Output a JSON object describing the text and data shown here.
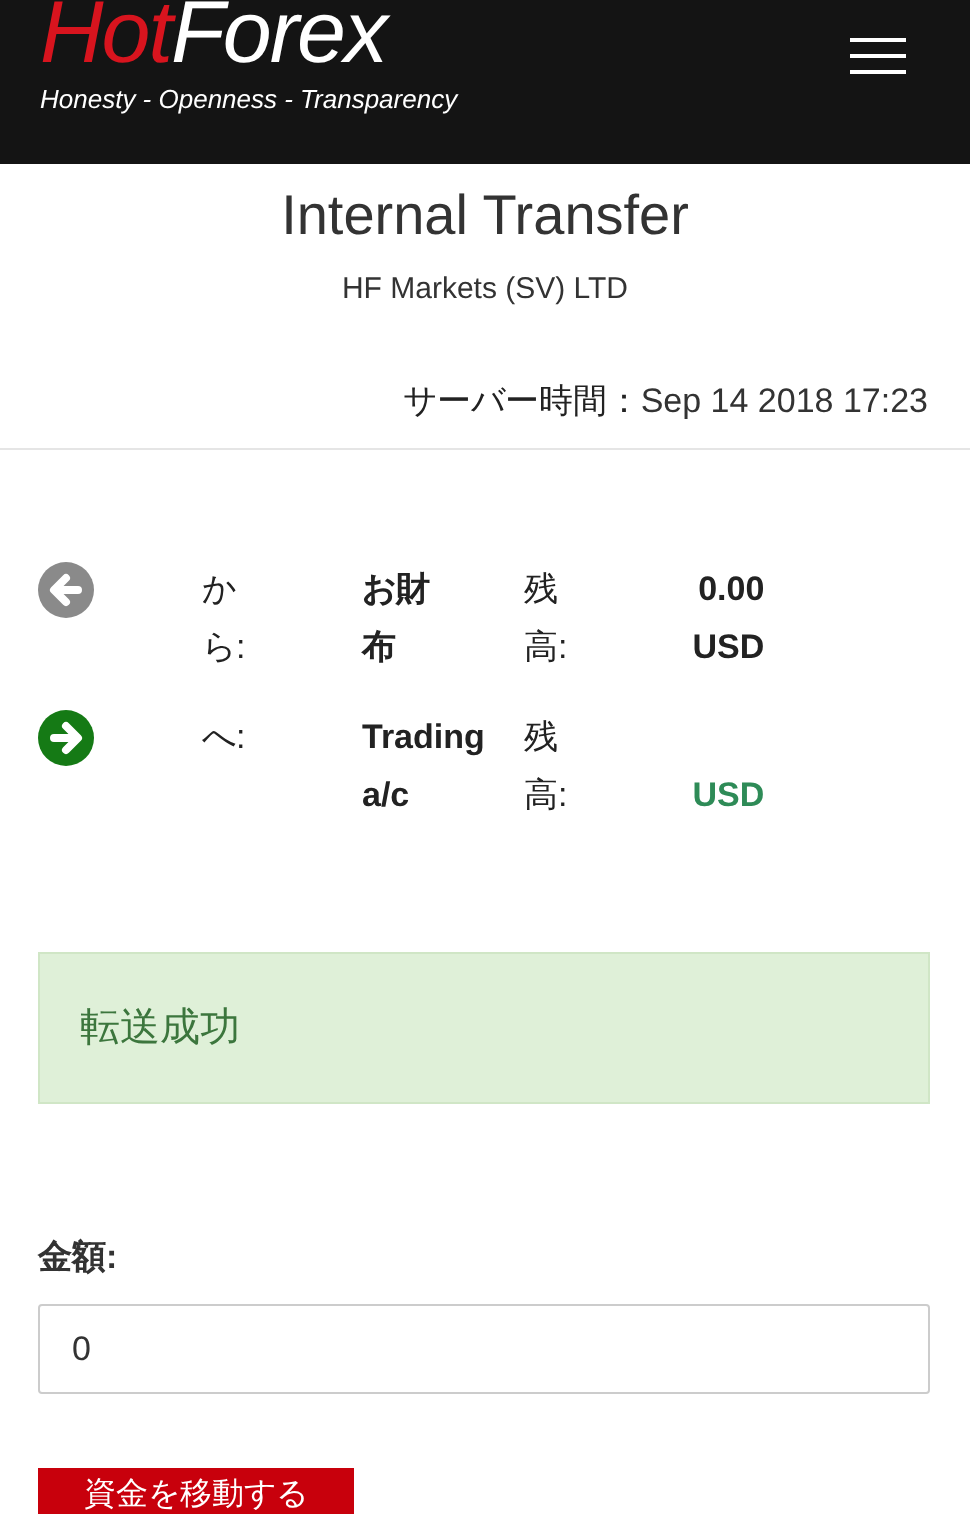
{
  "header": {
    "logo": {
      "red_part": "Hot",
      "white_part": "Forex",
      "tagline": "Honesty - Openness - Transparency"
    }
  },
  "title": "Internal Transfer",
  "subtitle": "HF Markets (SV) LTD",
  "server_time": {
    "label": "サーバー時間：",
    "value": "Sep 14 2018 17:23"
  },
  "accounts": [
    {
      "kind": "from",
      "label": "から:",
      "name": "お財布",
      "balance_label": "残高:",
      "balance": "0.00 USD",
      "color": "#222222"
    },
    {
      "kind": "to",
      "label": "へ:",
      "name": "Trading a/c",
      "balance_label": "残高:",
      "balance": "USD",
      "color": "#2e8b57"
    }
  ],
  "alert": {
    "text": "転送成功"
  },
  "amount": {
    "label": "金額:",
    "value": "0"
  },
  "submit_button": "資金を移動する"
}
